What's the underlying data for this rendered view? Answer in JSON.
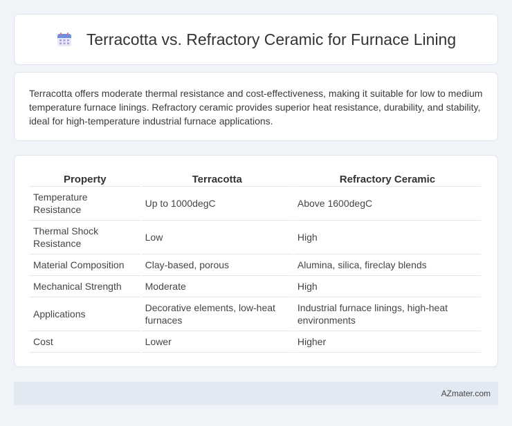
{
  "header": {
    "title": "Terracotta vs. Refractory Ceramic for Furnace Lining",
    "icon": "calendar-icon"
  },
  "description": "Terracotta offers moderate thermal resistance and cost-effectiveness, making it suitable for low to medium temperature furnace linings. Refractory ceramic provides superior heat resistance, durability, and stability, ideal for high-temperature industrial furnace applications.",
  "table": {
    "headers": [
      "Property",
      "Terracotta",
      "Refractory Ceramic"
    ],
    "rows": [
      [
        "Temperature Resistance",
        "Up to 1000degC",
        "Above 1600degC"
      ],
      [
        "Thermal Shock Resistance",
        "Low",
        "High"
      ],
      [
        "Material Composition",
        "Clay-based, porous",
        "Alumina, silica, fireclay blends"
      ],
      [
        "Mechanical Strength",
        "Moderate",
        "High"
      ],
      [
        "Applications",
        "Decorative elements, low-heat furnaces",
        "Industrial furnace linings, high-heat environments"
      ],
      [
        "Cost",
        "Lower",
        "Higher"
      ]
    ]
  },
  "footer": {
    "brand": "AZmater.com"
  }
}
